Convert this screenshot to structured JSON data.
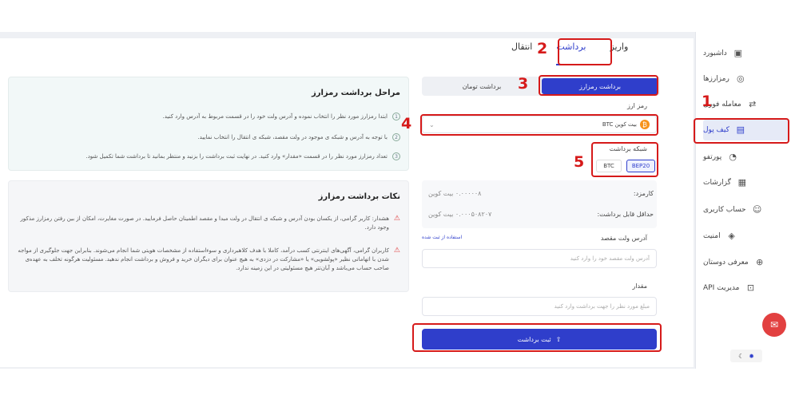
{
  "sidebar": {
    "items": [
      {
        "label": "داشبورد",
        "icon": "dashboard-icon"
      },
      {
        "label": "رمزارزها",
        "icon": "coins-icon"
      },
      {
        "label": "معامله فوری",
        "icon": "exchange-icon"
      },
      {
        "label": "کیف پول",
        "icon": "wallet-icon",
        "active": true
      },
      {
        "label": "پورتفو",
        "icon": "pie-chart-icon"
      },
      {
        "label": "گزارشات",
        "icon": "report-icon"
      },
      {
        "label": "حساب کاربری",
        "icon": "user-icon"
      },
      {
        "label": "امنیت",
        "icon": "shield-icon"
      },
      {
        "label": "معرفی دوستان",
        "icon": "add-user-icon"
      },
      {
        "label": "مدیریت API",
        "icon": "api-icon"
      }
    ]
  },
  "tabs": {
    "deposit": "واریز",
    "withdraw": "برداشت",
    "transfer": "انتقال"
  },
  "segment": {
    "crypto": "برداشت رمزارز",
    "toman": "برداشت تومان"
  },
  "form": {
    "coin_label": "رمز ارز",
    "coin_value": "بیت کوین BTC",
    "network_label": "شبکه برداشت",
    "networks": [
      "BEP20",
      "BTC"
    ],
    "fee_label": "کارمزد:",
    "fee_value": "۰.۰۰۰۰۰۸ بیت کوین",
    "max_label": "حداقل قابل برداشت:",
    "max_value": "۰.۰۰۰۵۰۸۲۰۷ بیت کوین",
    "address_label": "آدرس ولت مقصد",
    "address_link": "استفاده از ثبت شده",
    "address_placeholder": "آدرس ولت مقصد خود را وارد کنید",
    "amount_label": "مقدار",
    "amount_placeholder": "مبلغ مورد نظر را جهت برداشت وارد کنید",
    "submit": "ثبت برداشت"
  },
  "steps_card": {
    "title": "مراحل برداشت رمزارز",
    "steps": [
      "ابتدا رمزارز مورد نظر را انتخاب نموده و آدرس ولت خود را در قسمت مربوط به آدرس وارد کنید.",
      "با توجه به آدرس و شبکه ی موجود در ولت مقصد، شبکه ی انتقال را انتخاب نمایید.",
      "تعداد رمزارز مورد نظر را در قسمت «مقدار» وارد کنید. در نهایت ثبت برداشت را بزنید و منتظر بمانید تا برداشت شما تکمیل شود."
    ]
  },
  "notes_card": {
    "title": "نکات برداشت رمزارز",
    "notes": [
      "هشدار: کاربر گرامی، از یکسان بودن آدرس و شبکه ی انتقال در ولت مبدا و مقصد اطمینان حاصل فرمایید. در صورت مغایرت، امکان از بین رفتن رمزارز مذکور وجود دارد.",
      "کاربران گرامی، آگهی‌های اینترنتی کسب درآمد، کاملا با هدف کلاهبرداری و سوءاستفاده از مشخصات هویتی شما انجام می‌شوند. بنابراین جهت جلوگیری از مواجه شدن با اتهاماتی نظیر «پولشویی» یا «مشارکت در دزدی» به هیچ عنوان برای دیگران خرید و فروش و برداشت انجام ندهید. مسئولیت هرگونه تخلف به عهده‌ی صاحب حساب می‌باشد و آبان‌تتر هیچ مسئولیتی در این زمینه ندارد."
    ]
  },
  "annotations": [
    "1",
    "2",
    "3",
    "4",
    "5"
  ],
  "colors": {
    "accent": "#2f3ecb",
    "highlight": "#d61a1a"
  }
}
